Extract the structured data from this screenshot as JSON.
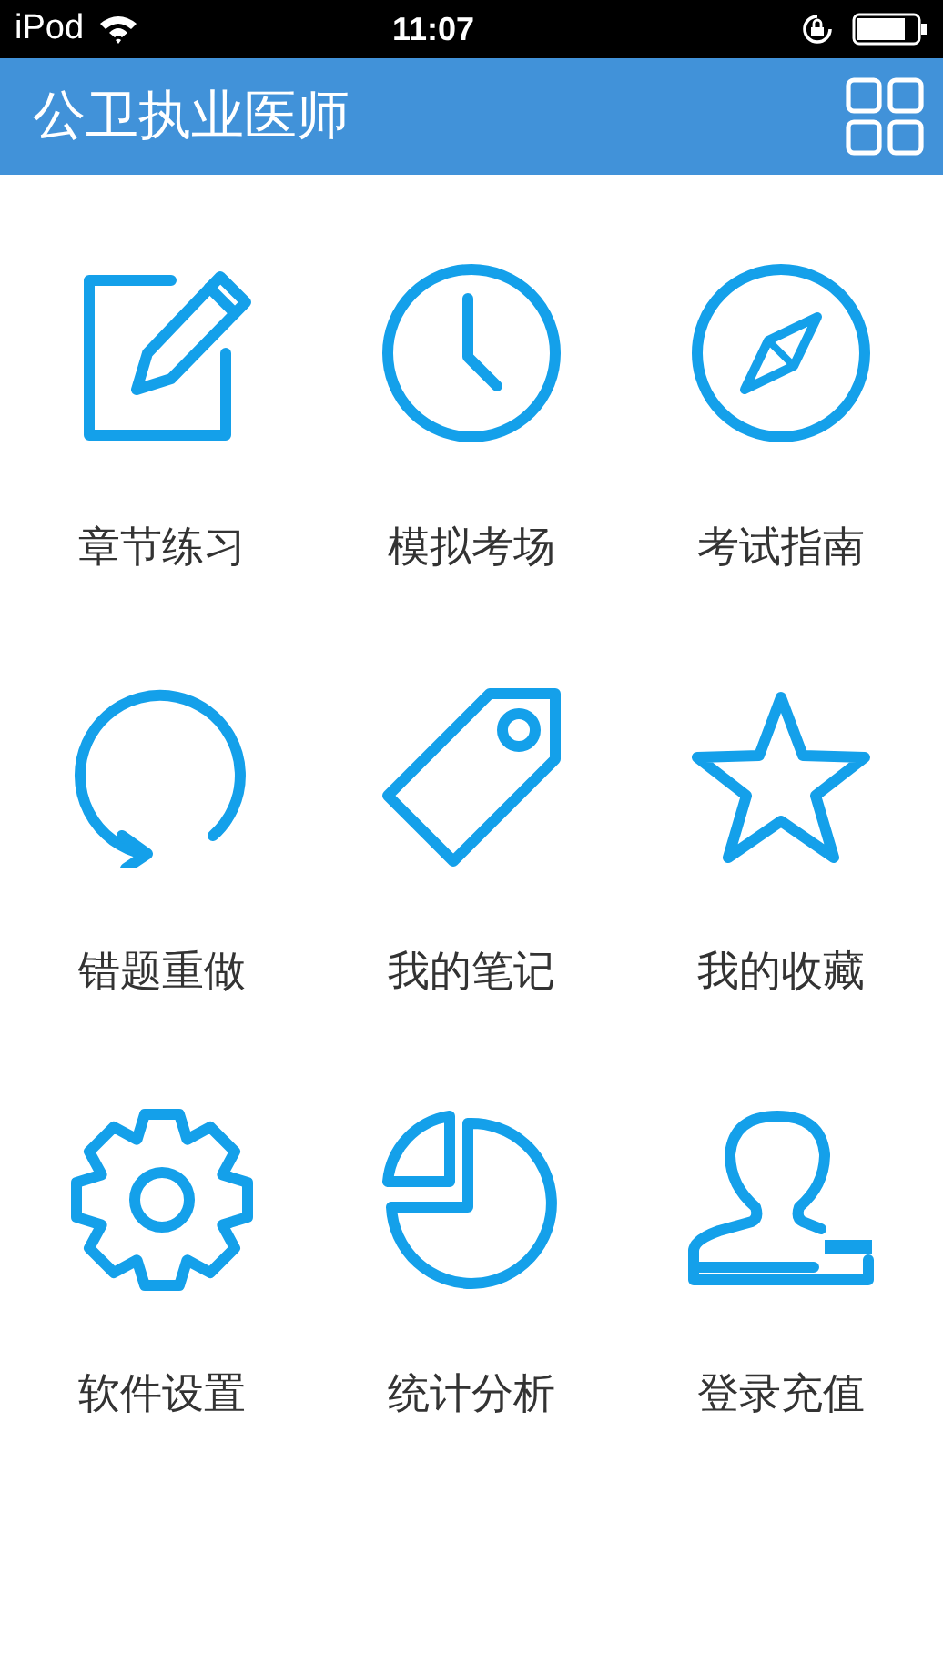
{
  "status_bar": {
    "carrier": "iPod",
    "time": "11:07"
  },
  "header": {
    "title": "公卫执业医师"
  },
  "menu": [
    {
      "label": "章节练习",
      "kind": "edit"
    },
    {
      "label": "模拟考场",
      "kind": "clock"
    },
    {
      "label": "考试指南",
      "kind": "compass"
    },
    {
      "label": "错题重做",
      "kind": "redo"
    },
    {
      "label": "我的笔记",
      "kind": "tag"
    },
    {
      "label": "我的收藏",
      "kind": "star"
    },
    {
      "label": "软件设置",
      "kind": "gear"
    },
    {
      "label": "统计分析",
      "kind": "pie"
    },
    {
      "label": "登录充值",
      "kind": "user"
    }
  ]
}
